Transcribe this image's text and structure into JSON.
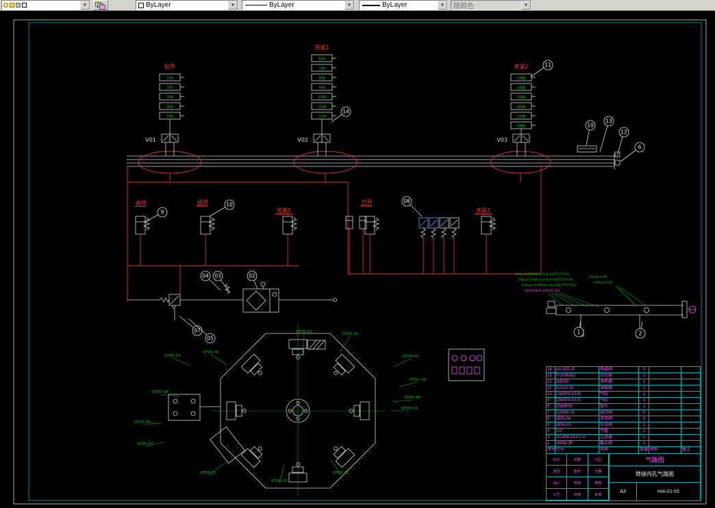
{
  "toolbar": {
    "layer_combo": {
      "value": ""
    },
    "color_combo": {
      "value": "ByLayer"
    },
    "linetype_combo": {
      "value": "ByLayer"
    },
    "lineweight_combo": {
      "value": "ByLayer"
    },
    "plotstyle_combo": {
      "value": "随颜色"
    }
  },
  "drawing": {
    "valve_groups": [
      {
        "label": "松开",
        "valve_id": "V01",
        "coils": [
          "1YA",
          "2YA",
          "3YA",
          "4YA",
          "5YA"
        ]
      },
      {
        "label": "夹紧1",
        "valve_id": "V02",
        "coils": [
          "6YA",
          "7YA",
          "8YA",
          "9YA",
          "10YA",
          "11YA",
          "12YA"
        ]
      },
      {
        "label": "夹紧2",
        "valve_id": "V03",
        "coils": [
          "13YA",
          "14YA",
          "15YA",
          "16YA",
          "17YA",
          "18YA"
        ]
      }
    ],
    "station_labels": [
      "由锁",
      "插锁",
      "夹紧1",
      "打开",
      "夹紧2"
    ],
    "callouts": [
      "11",
      "14",
      "10",
      "13",
      "12",
      "6",
      "9",
      "10",
      "08",
      "04",
      "03",
      "02",
      "07",
      "05",
      "1",
      "2"
    ],
    "machine_labels": [
      "GT05-04",
      "GT05-05",
      "GT05-03",
      "GT05-02",
      "GT05-01",
      "GT05-14",
      "GT05-08",
      "GT05-09",
      "GT05-10",
      "GT05-06",
      "GT05-07",
      "GT05-12",
      "GT05-13",
      "GT05-11"
    ],
    "manifold_notes": [
      "PU8x5-2A(M10x1)A-8-GB/T5777-R2",
      "PU8x5-2A(M10x1)A-8-GB/T5777-R1",
      "PU6x4-2A(M10x1)A-8-GB/T5777-R2",
      "KIA PU8x5 (HIA-01-03)",
      "PU8x5-8-R2",
      "PU6x4-8-R1"
    ]
  },
  "bom": {
    "columns": [
      "序号",
      "代号",
      "名称",
      "数量",
      "材料",
      "备注"
    ],
    "rows": [
      {
        "no": "16",
        "code": "4A-320-J0",
        "name": "电磁阀",
        "qty": "3",
        "mat": "",
        "rem": ""
      },
      {
        "no": "13",
        "code": "P-200MA2",
        "name": "压力表",
        "qty": "1",
        "mat": "",
        "rem": ""
      },
      {
        "no": "12",
        "code": "A3P03",
        "name": "消声器",
        "qty": "1",
        "mat": "",
        "rem": ""
      },
      {
        "no": "11",
        "code": "A2L10-0L",
        "name": "油雾器",
        "qty": "1",
        "mat": "",
        "rem": ""
      },
      {
        "no": "10",
        "code": "CM3PN-03-R",
        "name": "气缸",
        "qty": "1",
        "mat": "",
        "rem": ""
      },
      {
        "no": "9",
        "code": "CM3PN-03-S",
        "name": "气缸",
        "qty": "1",
        "mat": "",
        "rem": ""
      },
      {
        "no": "8",
        "code": "CM3R06",
        "name": "接头",
        "qty": "1",
        "mat": "",
        "rem": ""
      },
      {
        "no": "7",
        "code": "GZ400-15",
        "name": "减压阀",
        "qty": "6",
        "mat": "",
        "rem": ""
      },
      {
        "no": "6",
        "code": "3PSL04",
        "name": "节流阀",
        "qty": "1",
        "mat": "",
        "rem": ""
      },
      {
        "no": "5",
        "code": "3PSL03",
        "name": "节流阀",
        "qty": "1",
        "mat": "",
        "rem": ""
      },
      {
        "no": "4",
        "code": "1/2\"",
        "name": "气管",
        "qty": "1",
        "mat": "",
        "rem": ""
      },
      {
        "no": "3",
        "code": "GC400-15-F1-A",
        "name": "过滤器",
        "qty": "1",
        "mat": "",
        "rem": ""
      },
      {
        "no": "1",
        "code": "300W-3F",
        "name": "截止阀",
        "qty": "1",
        "mat": "",
        "rem": ""
      }
    ],
    "title": {
      "drawing_title": "气路图",
      "project": "转接内孔气路图",
      "sheet": "A3",
      "number": "HIA-01-03",
      "small_cells": [
        "标记",
        "处数",
        "分区",
        "更改",
        "签字",
        "日期",
        "设计",
        "校核",
        "审核",
        "工艺",
        "标准",
        "批准"
      ]
    }
  }
}
